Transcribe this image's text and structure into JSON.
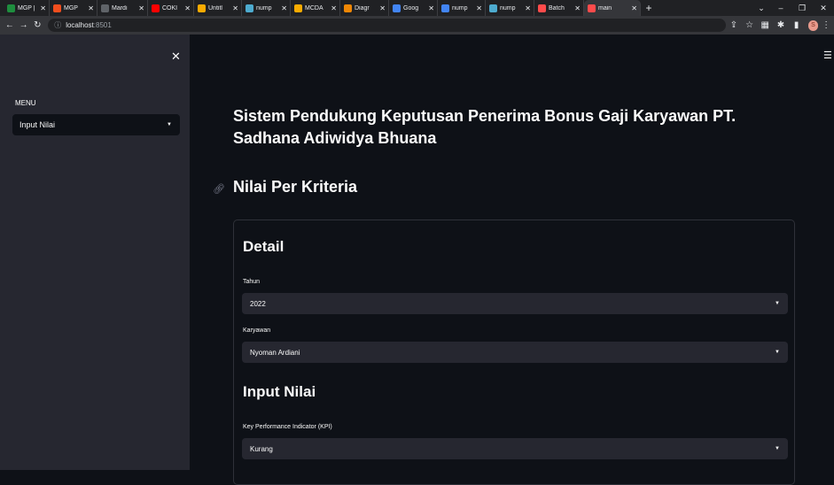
{
  "browser": {
    "tabs": [
      {
        "label": "MGP |",
        "icon": "sheets-icon",
        "color": "#1e8e3e"
      },
      {
        "label": "MGP",
        "icon": "figma-icon",
        "color": "#f24e1e"
      },
      {
        "label": "Mardi",
        "icon": "globe-icon",
        "color": "#5f6368"
      },
      {
        "label": "COKI",
        "icon": "youtube-icon",
        "color": "#ff0000"
      },
      {
        "label": "Untitl",
        "icon": "colab-icon",
        "color": "#f9ab00"
      },
      {
        "label": "nump",
        "icon": "numpy-icon",
        "color": "#4dabcf"
      },
      {
        "label": "MCDA",
        "icon": "colab-icon",
        "color": "#f9ab00"
      },
      {
        "label": "Diagr",
        "icon": "drawio-icon",
        "color": "#f08705"
      },
      {
        "label": "Goog",
        "icon": "docs-icon",
        "color": "#4285f4"
      },
      {
        "label": "nump",
        "icon": "chrome-icon",
        "color": "#4285f4"
      },
      {
        "label": "nump",
        "icon": "numpy-icon",
        "color": "#4dabcf"
      },
      {
        "label": "Batch",
        "icon": "streamlit-icon",
        "color": "#ff4b4b"
      },
      {
        "label": "main",
        "icon": "streamlit-icon",
        "color": "#ff4b4b",
        "active": true
      }
    ],
    "new_tab": "+",
    "address": {
      "host": "localhost",
      "port": ":8501"
    }
  },
  "sidebar": {
    "menu_label": "MENU",
    "menu_selected": "Input Nilai"
  },
  "main": {
    "title": "Sistem Pendukung Keputusan Penerima Bonus Gaji Karyawan PT. Sadhana Adiwidya Bhuana",
    "subheader": "Nilai Per Kriteria",
    "form": {
      "detail_heading": "Detail",
      "tahun_label": "Tahun",
      "tahun_value": "2022",
      "karyawan_label": "Karyawan",
      "karyawan_value": "Nyoman Ardiani",
      "input_heading": "Input Nilai",
      "kpi_label": "Key Performance Indicator (KPI)",
      "kpi_value": "Kurang"
    }
  }
}
